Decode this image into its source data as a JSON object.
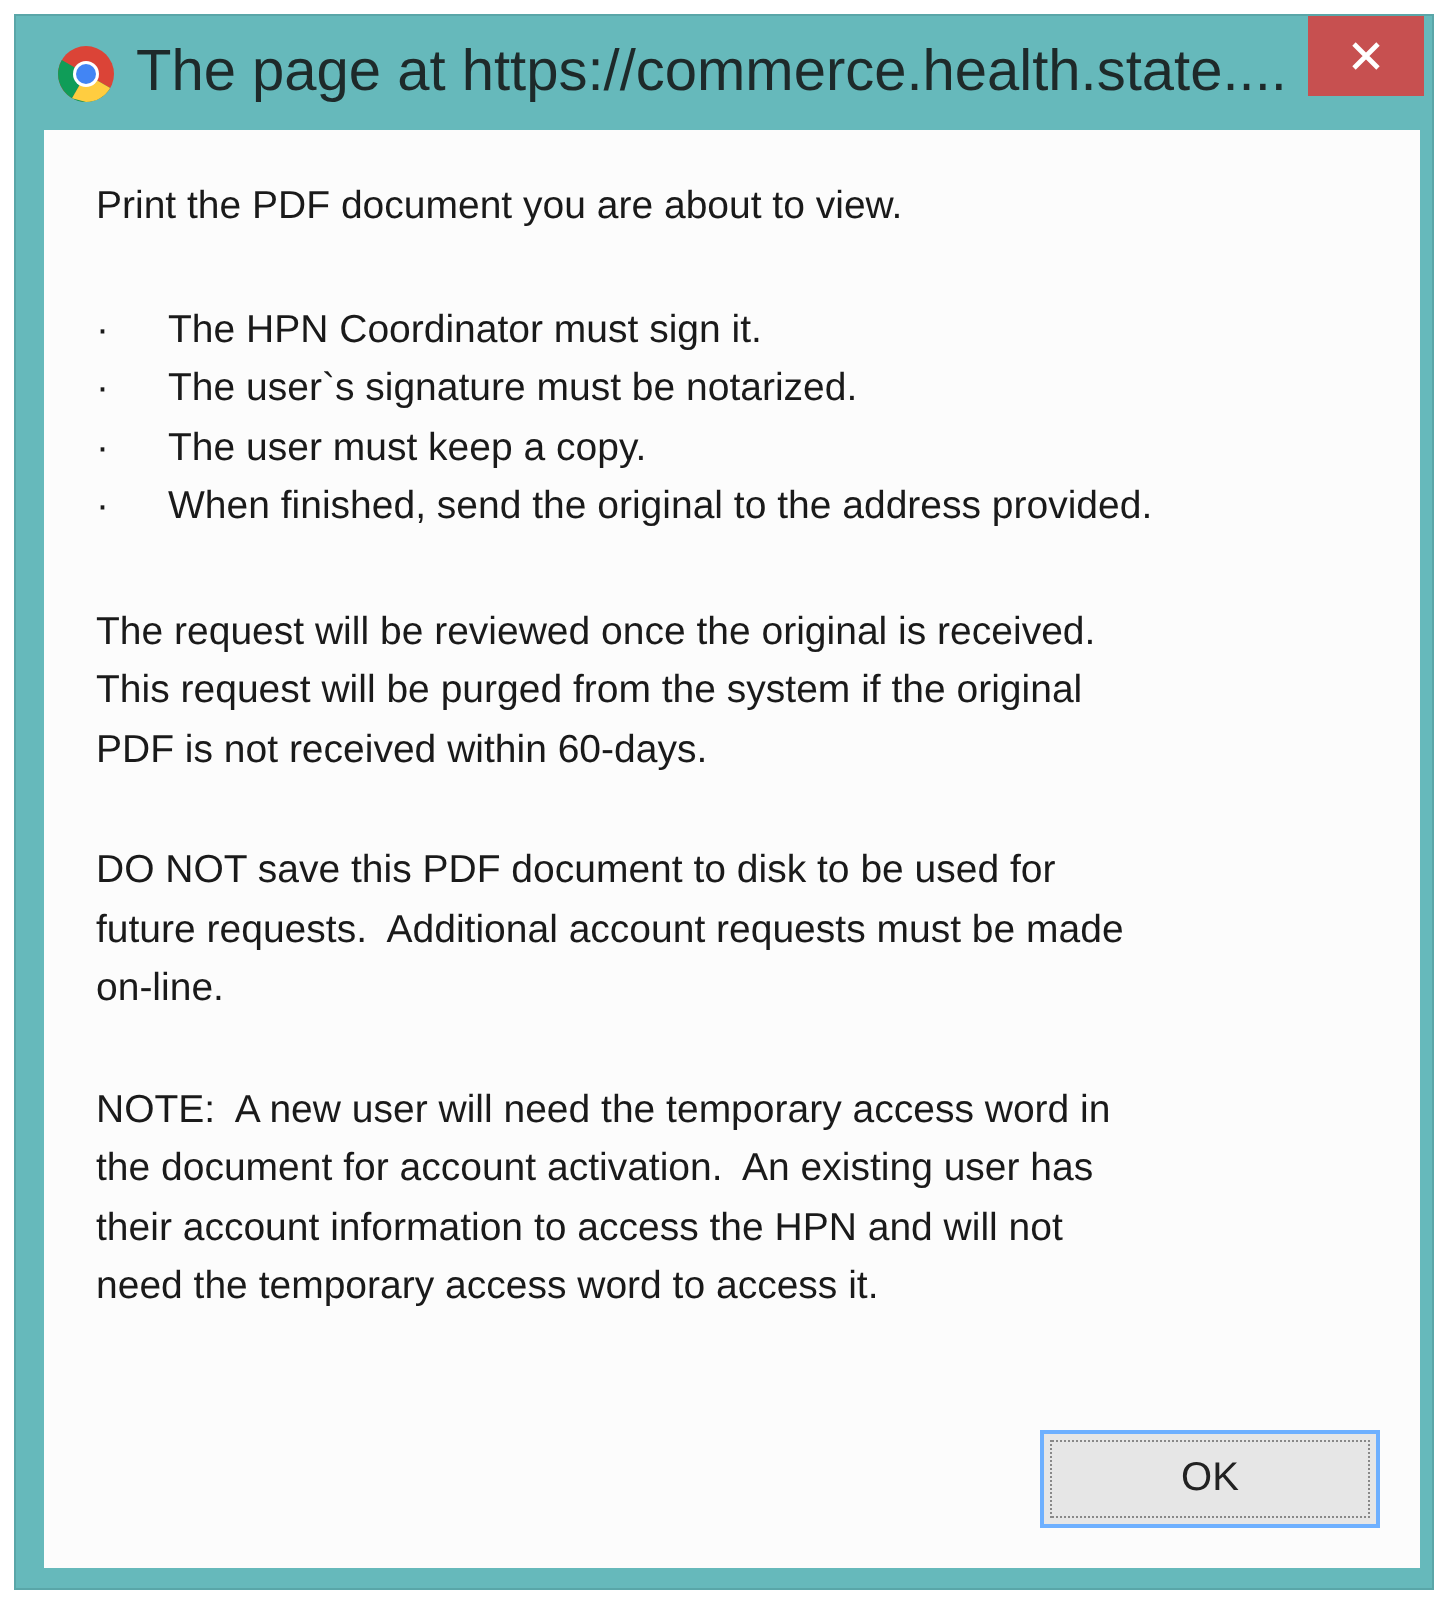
{
  "window": {
    "title": "The page at https://commerce.health.state...."
  },
  "intro": "Print the PDF document you are about to view.",
  "bullets": [
    {
      "marker": "·",
      "text": "The HPN Coordinator must sign it."
    },
    {
      "marker": "·",
      "text": "The user`s signature must be notarized."
    },
    {
      "marker": "·",
      "text": "The user must keep a copy."
    },
    {
      "marker": "·",
      "text": "When finished, send the original to the address provided."
    }
  ],
  "paragraphs": [
    "The request will be reviewed once the original is received.\nThis request will be purged from the system if the original\nPDF is not received within 60-days.",
    "DO NOT save this PDF document to disk to be used for\nfuture requests.  Additional account requests must be made\non-line.",
    "NOTE:  A new user will need the temporary access word in\nthe document for account activation.  An existing user has\ntheir account information to access the HPN and will not\nneed the temporary access word to access it."
  ],
  "buttons": [
    {
      "label": "OK",
      "focused": true
    }
  ]
}
